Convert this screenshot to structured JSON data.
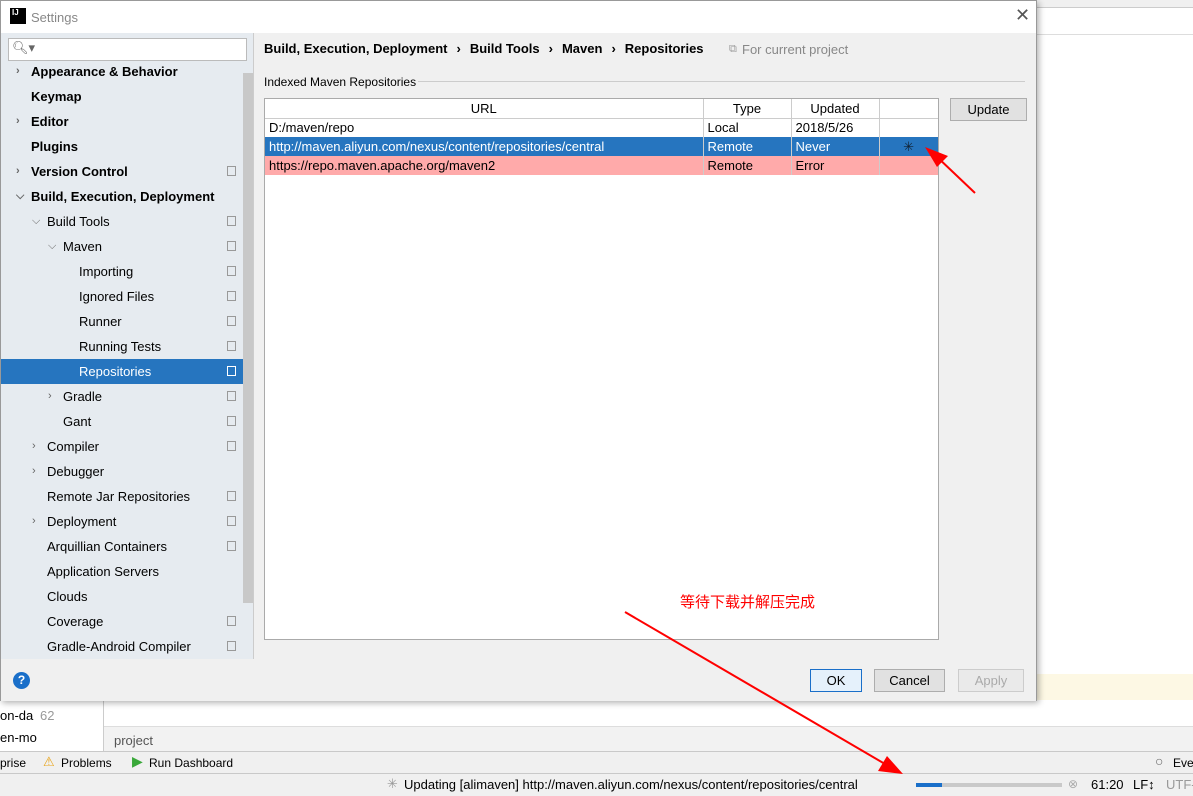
{
  "dialog": {
    "title": "Settings",
    "help": "?"
  },
  "search": {
    "placeholder": ""
  },
  "tree": [
    {
      "label": "Appearance & Behavior",
      "level": 0,
      "arrow": "right",
      "bold": true,
      "copy": false
    },
    {
      "label": "Keymap",
      "level": 0,
      "arrow": "",
      "bold": true,
      "copy": false
    },
    {
      "label": "Editor",
      "level": 0,
      "arrow": "right",
      "bold": true,
      "copy": false
    },
    {
      "label": "Plugins",
      "level": 0,
      "arrow": "",
      "bold": true,
      "copy": false
    },
    {
      "label": "Version Control",
      "level": 0,
      "arrow": "right",
      "bold": true,
      "copy": true
    },
    {
      "label": "Build, Execution, Deployment",
      "level": 0,
      "arrow": "down",
      "bold": true,
      "copy": false
    },
    {
      "label": "Build Tools",
      "level": 1,
      "arrow": "down",
      "bold": false,
      "copy": true
    },
    {
      "label": "Maven",
      "level": 2,
      "arrow": "down",
      "bold": false,
      "copy": true
    },
    {
      "label": "Importing",
      "level": 3,
      "arrow": "",
      "bold": false,
      "copy": true
    },
    {
      "label": "Ignored Files",
      "level": 3,
      "arrow": "",
      "bold": false,
      "copy": true
    },
    {
      "label": "Runner",
      "level": 3,
      "arrow": "",
      "bold": false,
      "copy": true
    },
    {
      "label": "Running Tests",
      "level": 3,
      "arrow": "",
      "bold": false,
      "copy": true
    },
    {
      "label": "Repositories",
      "level": 3,
      "arrow": "",
      "bold": false,
      "copy": true,
      "selected": true
    },
    {
      "label": "Gradle",
      "level": 2,
      "arrow": "right",
      "bold": false,
      "copy": true
    },
    {
      "label": "Gant",
      "level": 2,
      "arrow": "",
      "bold": false,
      "copy": true
    },
    {
      "label": "Compiler",
      "level": 1,
      "arrow": "right",
      "bold": false,
      "copy": true
    },
    {
      "label": "Debugger",
      "level": 1,
      "arrow": "right",
      "bold": false,
      "copy": false
    },
    {
      "label": "Remote Jar Repositories",
      "level": 1,
      "arrow": "",
      "bold": false,
      "copy": true
    },
    {
      "label": "Deployment",
      "level": 1,
      "arrow": "right",
      "bold": false,
      "copy": true
    },
    {
      "label": "Arquillian Containers",
      "level": 1,
      "arrow": "",
      "bold": false,
      "copy": true
    },
    {
      "label": "Application Servers",
      "level": 1,
      "arrow": "",
      "bold": false,
      "copy": false
    },
    {
      "label": "Clouds",
      "level": 1,
      "arrow": "",
      "bold": false,
      "copy": false
    },
    {
      "label": "Coverage",
      "level": 1,
      "arrow": "",
      "bold": false,
      "copy": true
    },
    {
      "label": "Gradle-Android Compiler",
      "level": 1,
      "arrow": "",
      "bold": false,
      "copy": true
    }
  ],
  "breadcrumb": [
    "Build, Execution, Deployment",
    "Build Tools",
    "Maven",
    "Repositories"
  ],
  "scope": "For current project",
  "section_title": "Indexed Maven Repositories",
  "table": {
    "headers": [
      "URL",
      "Type",
      "Updated",
      ""
    ],
    "rows": [
      {
        "url": "D:/maven/repo",
        "type": "Local",
        "updated": "2018/5/26",
        "state": "normal"
      },
      {
        "url": "http://maven.aliyun.com/nexus/content/repositories/central",
        "type": "Remote",
        "updated": "Never",
        "state": "selected"
      },
      {
        "url": "https://repo.maven.apache.org/maven2",
        "type": "Remote",
        "updated": "Error",
        "state": "error"
      }
    ]
  },
  "buttons": {
    "update": "Update",
    "ok": "OK",
    "cancel": "Cancel",
    "apply": "Apply"
  },
  "annotation": "等待下载并解压完成",
  "background": {
    "line_number": "62",
    "left1": "on-da",
    "left2": "en-mo",
    "project": "project",
    "tool_prise": "prise",
    "problems": "Problems",
    "run_dashboard": "Run Dashboard",
    "event": "Eve"
  },
  "status": {
    "message": "Updating [alimaven] http://maven.aliyun.com/nexus/content/repositories/central",
    "progress": 0.18,
    "position": "61:20",
    "line_sep": "LF↕",
    "encoding": "UTF-"
  },
  "colors": {
    "selection": "#2675bf",
    "error_row": "#ffaaaa",
    "annotation": "#ff0000"
  }
}
